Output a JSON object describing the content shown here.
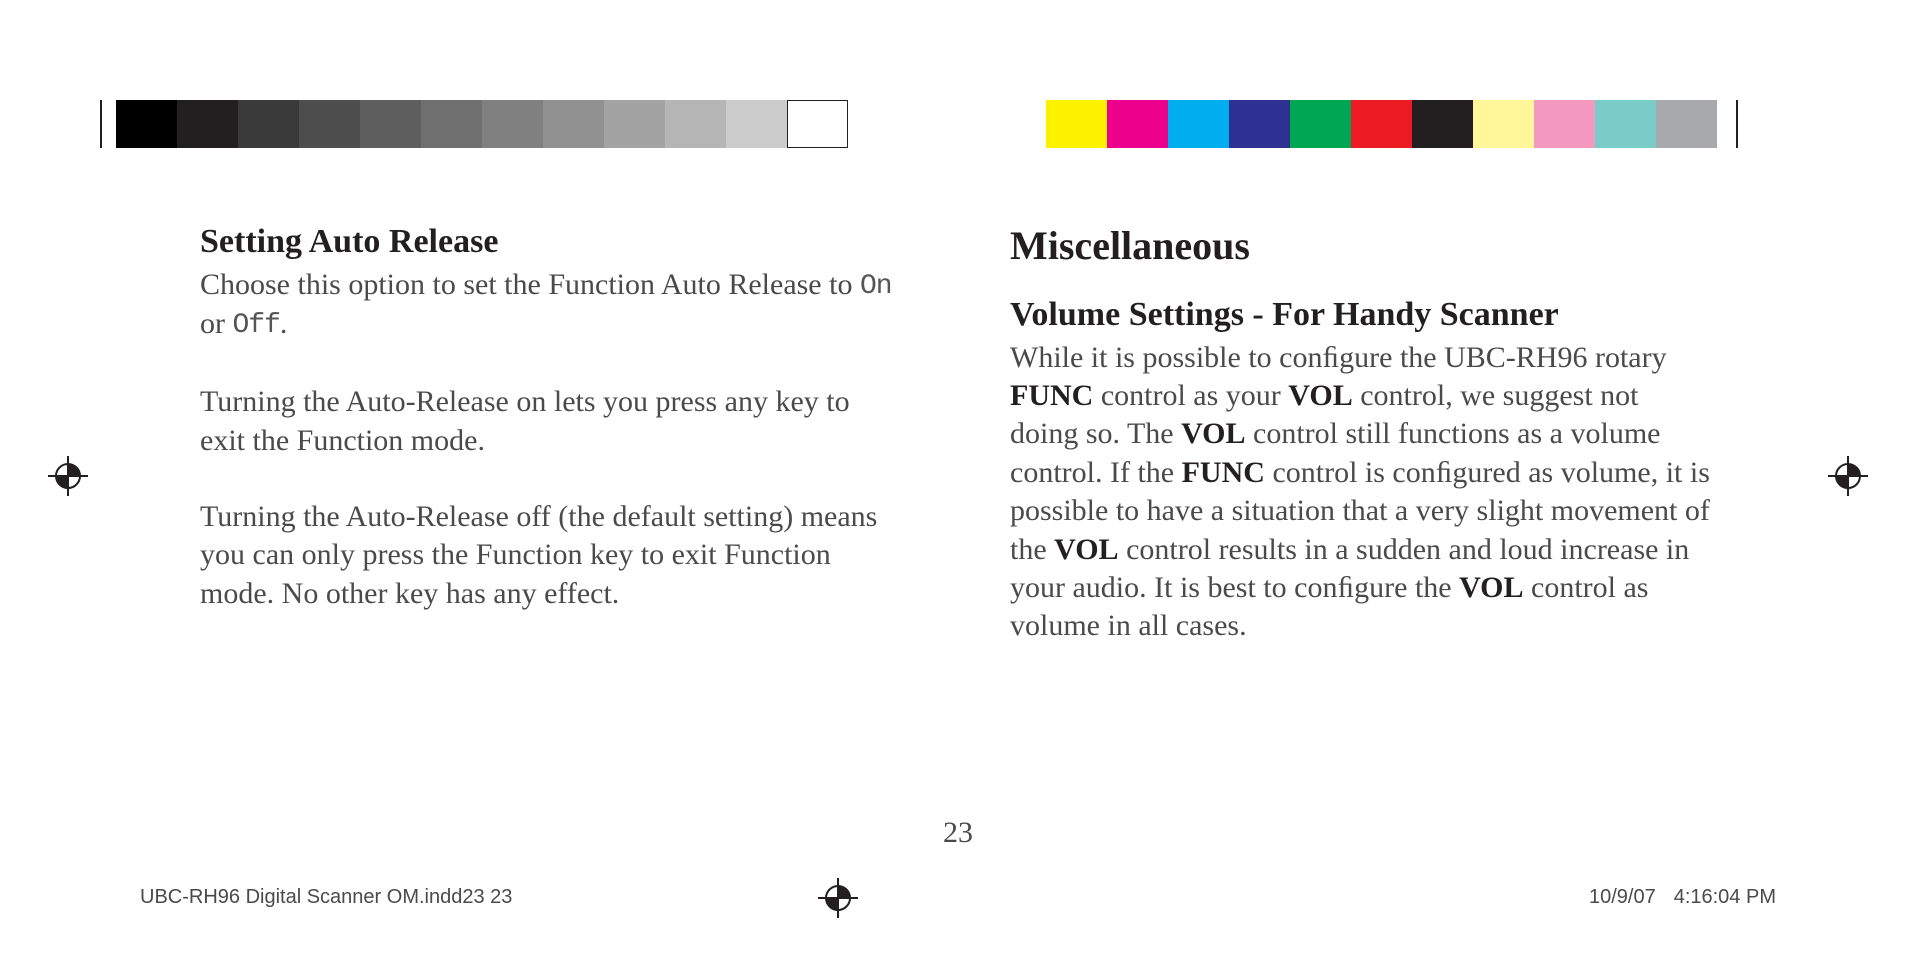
{
  "left_col": {
    "heading": "Setting Auto Release",
    "p1_prefix": "Choose this option to set the Function Auto Release to ",
    "p1_on": "On",
    "p1_or": " or ",
    "p1_off": "Off",
    "p1_suffix": ".",
    "p2": "Turning the Auto-Release on lets you press any key to exit the Function mode.",
    "p3": "Turning the Auto-Release off (the default setting) means you can only press the Function key to exit Function mode. No other key has any effect."
  },
  "right_col": {
    "section_heading": "Miscellaneous",
    "heading": "Volume Settings - For Handy Scanner",
    "p1_a": "While it is possible to conﬁgure the UBC-RH96 rotary ",
    "p1_b": "FUNC",
    "p1_c": " control as your ",
    "p1_d": "VOL",
    "p1_e": " control, we suggest not doing so. The ",
    "p1_f": "VOL",
    "p1_g": " control still functions as a volume control. If the ",
    "p1_h": "FUNC",
    "p1_i": " control is conﬁgured as volume, it is possible to have a situation that a very slight movement of the ",
    "p1_j": "VOL",
    "p1_k": " control results in a sudden and loud increase in your audio. It is best to conﬁgure the ",
    "p1_l": "VOL",
    "p1_m": " control as volume in all cases."
  },
  "page_number": "23",
  "footer": {
    "left": "UBC-RH96 Digital Scanner OM.indd23   23",
    "date": "10/9/07",
    "time": "4:16:04 PM"
  },
  "swatches_left": [
    "#000000",
    "#231f20",
    "#3a3a3a",
    "#4d4d4d",
    "#5e5e5e",
    "#6f6f6f",
    "#808080",
    "#919191",
    "#a3a3a3",
    "#b5b5b5",
    "#cccccc",
    "#ffffff"
  ],
  "swatches_right": [
    "#fff200",
    "#ec008c",
    "#00aeef",
    "#2e3192",
    "#00a651",
    "#ed1c24",
    "#231f20",
    "#fff799",
    "#f49ac1",
    "#7accc8",
    "#a7a9ac"
  ]
}
